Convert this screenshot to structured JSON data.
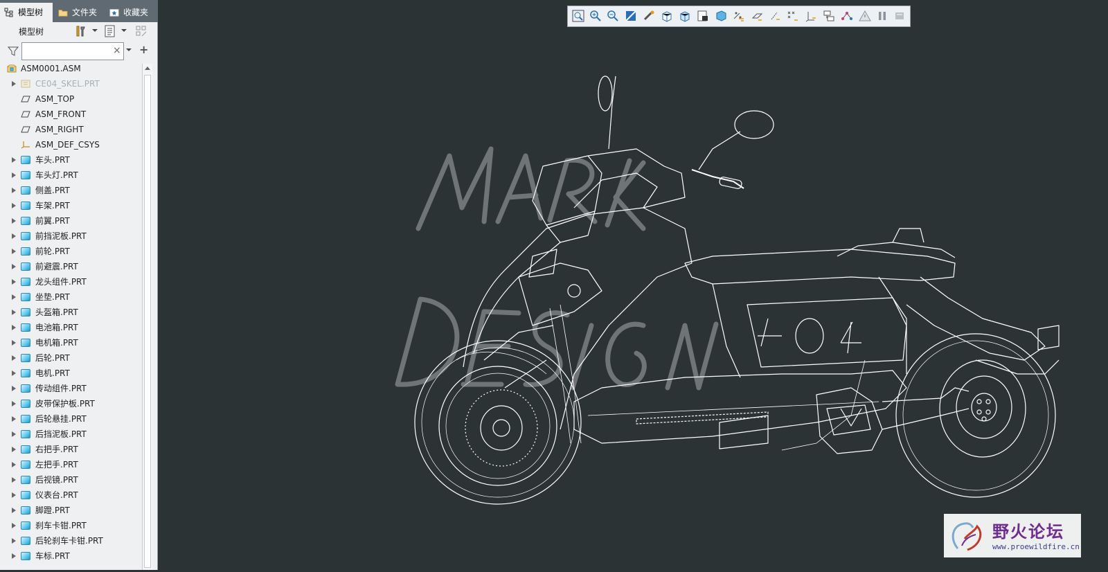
{
  "sidebar": {
    "tabs": [
      {
        "label": "模型树",
        "icon": "model-tree-icon",
        "active": true
      },
      {
        "label": "文件夹",
        "icon": "folder-icon",
        "active": false
      },
      {
        "label": "收藏夹",
        "icon": "favorites-icon",
        "active": false
      }
    ],
    "panel_title": "模型树",
    "search": {
      "value": "",
      "placeholder": ""
    },
    "tree": [
      {
        "label": "ASM0001.ASM",
        "icon": "assembly-icon",
        "expandable": false,
        "root": true
      },
      {
        "label": "CE04_SKEL.PRT",
        "icon": "skeleton-icon",
        "expandable": true,
        "dim": true
      },
      {
        "label": "ASM_TOP",
        "icon": "datum-plane-icon",
        "expandable": false
      },
      {
        "label": "ASM_FRONT",
        "icon": "datum-plane-icon",
        "expandable": false
      },
      {
        "label": "ASM_RIGHT",
        "icon": "datum-plane-icon",
        "expandable": false
      },
      {
        "label": "ASM_DEF_CSYS",
        "icon": "csys-icon",
        "expandable": false
      },
      {
        "label": "车头.PRT",
        "icon": "part-icon",
        "expandable": true
      },
      {
        "label": "车头灯.PRT",
        "icon": "part-icon",
        "expandable": true
      },
      {
        "label": "侧盖.PRT",
        "icon": "part-icon",
        "expandable": true
      },
      {
        "label": "车架.PRT",
        "icon": "part-icon",
        "expandable": true
      },
      {
        "label": "前翼.PRT",
        "icon": "part-icon",
        "expandable": true
      },
      {
        "label": "前挡泥板.PRT",
        "icon": "part-icon",
        "expandable": true
      },
      {
        "label": "前轮.PRT",
        "icon": "part-icon",
        "expandable": true
      },
      {
        "label": "前避震.PRT",
        "icon": "part-icon",
        "expandable": true
      },
      {
        "label": "龙头组件.PRT",
        "icon": "part-icon",
        "expandable": true
      },
      {
        "label": "坐垫.PRT",
        "icon": "part-icon",
        "expandable": true
      },
      {
        "label": "头盔箱.PRT",
        "icon": "part-icon",
        "expandable": true
      },
      {
        "label": "电池箱.PRT",
        "icon": "part-icon",
        "expandable": true
      },
      {
        "label": "电机箱.PRT",
        "icon": "part-icon",
        "expandable": true
      },
      {
        "label": "后轮.PRT",
        "icon": "part-icon",
        "expandable": true
      },
      {
        "label": "电机.PRT",
        "icon": "part-icon",
        "expandable": true
      },
      {
        "label": "传动组件.PRT",
        "icon": "part-icon",
        "expandable": true
      },
      {
        "label": "皮带保护板.PRT",
        "icon": "part-icon",
        "expandable": true
      },
      {
        "label": "后轮悬挂.PRT",
        "icon": "part-icon",
        "expandable": true
      },
      {
        "label": "后挡泥板.PRT",
        "icon": "part-icon",
        "expandable": true
      },
      {
        "label": "右把手.PRT",
        "icon": "part-icon",
        "expandable": true
      },
      {
        "label": "左把手.PRT",
        "icon": "part-icon",
        "expandable": true
      },
      {
        "label": "后视镜.PRT",
        "icon": "part-icon",
        "expandable": true
      },
      {
        "label": "仪表台.PRT",
        "icon": "part-icon",
        "expandable": true
      },
      {
        "label": "脚蹬.PRT",
        "icon": "part-icon",
        "expandable": true
      },
      {
        "label": "刹车卡钳.PRT",
        "icon": "part-icon",
        "expandable": true
      },
      {
        "label": "后轮刹车卡钳.PRT",
        "icon": "part-icon",
        "expandable": true
      },
      {
        "label": "车标.PRT",
        "icon": "part-icon",
        "expandable": true
      }
    ]
  },
  "view_toolbar": {
    "buttons": [
      "refit-icon",
      "zoom-in-icon",
      "zoom-out-icon",
      "repaint-icon",
      "spin-center-icon",
      "view-orientation-icon",
      "saved-views-icon",
      "display-style-icon",
      "section-icon",
      "plane-display-icon",
      "axis-display-icon",
      "point-display-icon",
      "csys-display-icon",
      "annotation-display-icon",
      "appearance-icon",
      "spin-icon",
      "warning-icon",
      "pause-icon",
      "stop-icon"
    ]
  },
  "model_overlay": {
    "text": "MARK DESIGN",
    "tank_text": "404"
  },
  "watermark": {
    "brand_cn": "野火论坛",
    "url": "www.proewildfire.cn"
  },
  "colors": {
    "viewport_bg": "#2c3334",
    "wire": "#ffffff",
    "panel_bg": "#eef0f2"
  }
}
